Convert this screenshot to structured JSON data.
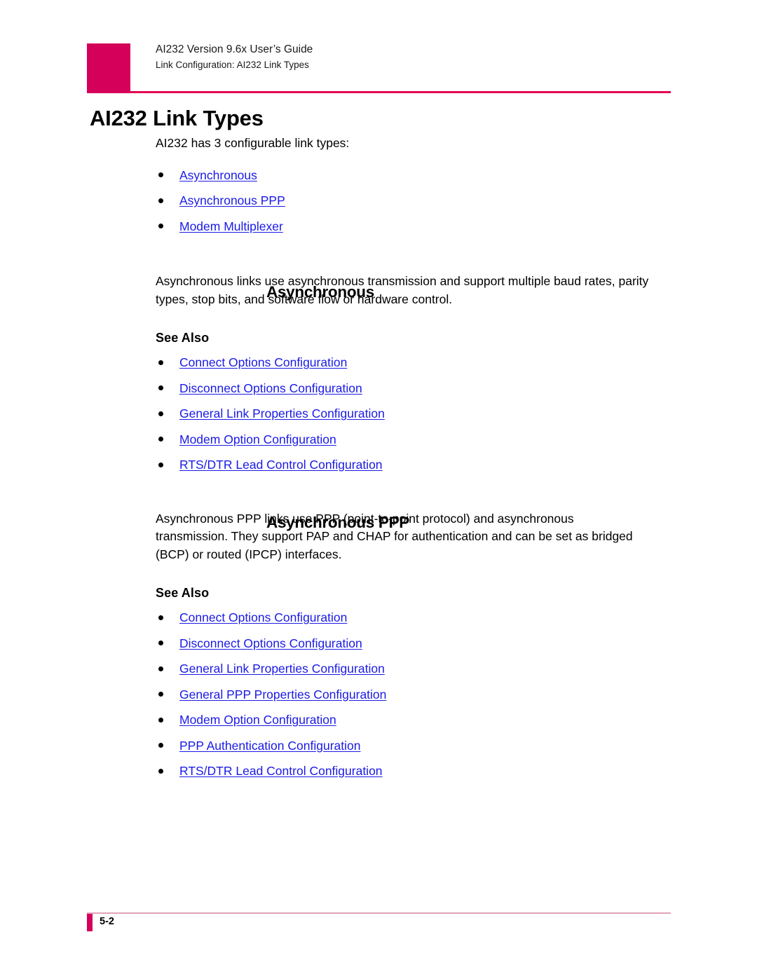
{
  "header": {
    "title_line1": "AI232 Version 9.6x User’s Guide",
    "title_line2": "Link Configuration: AI232 Link Types",
    "accent_color": "#d4005a",
    "rule_color": "#e4004f"
  },
  "page": {
    "title": "AI232 Link Types",
    "intro": "AI232 has 3 configurable link types:",
    "link_color": "#1a1ae6"
  },
  "toc_links": [
    {
      "label": "Asynchronous"
    },
    {
      "label": "Asynchronous PPP"
    },
    {
      "label": "Modem Multiplexer"
    }
  ],
  "sections": [
    {
      "heading": "Asynchronous",
      "body": "Asynchronous links use asynchronous transmission and support multiple baud rates, parity types, stop bits, and software flow or hardware control.",
      "see_also_label": "See Also",
      "see_also": [
        {
          "label": "Connect Options Configuration"
        },
        {
          "label": "Disconnect Options Configuration"
        },
        {
          "label": "General Link Properties Configuration"
        },
        {
          "label": "Modem Option Configuration"
        },
        {
          "label": "RTS/DTR Lead Control Configuration"
        }
      ]
    },
    {
      "heading": "Asynchronous PPP",
      "body": "Asynchronous PPP links use PPP (point-to-point protocol) and asynchronous transmission. They support PAP and CHAP for authentication and can be set as bridged (BCP) or routed (IPCP) interfaces.",
      "see_also_label": "See Also",
      "see_also": [
        {
          "label": "Connect Options Configuration"
        },
        {
          "label": "Disconnect Options Configuration"
        },
        {
          "label": "General Link Properties Configuration"
        },
        {
          "label": "General PPP Properties Configuration"
        },
        {
          "label": "Modem Option Configuration"
        },
        {
          "label": "PPP Authentication Configuration"
        },
        {
          "label": "RTS/DTR Lead Control Configuration"
        }
      ]
    }
  ],
  "footer": {
    "page_number": "5-2",
    "accent_color": "#d4005a",
    "rule_color": "#e2a2bd"
  }
}
